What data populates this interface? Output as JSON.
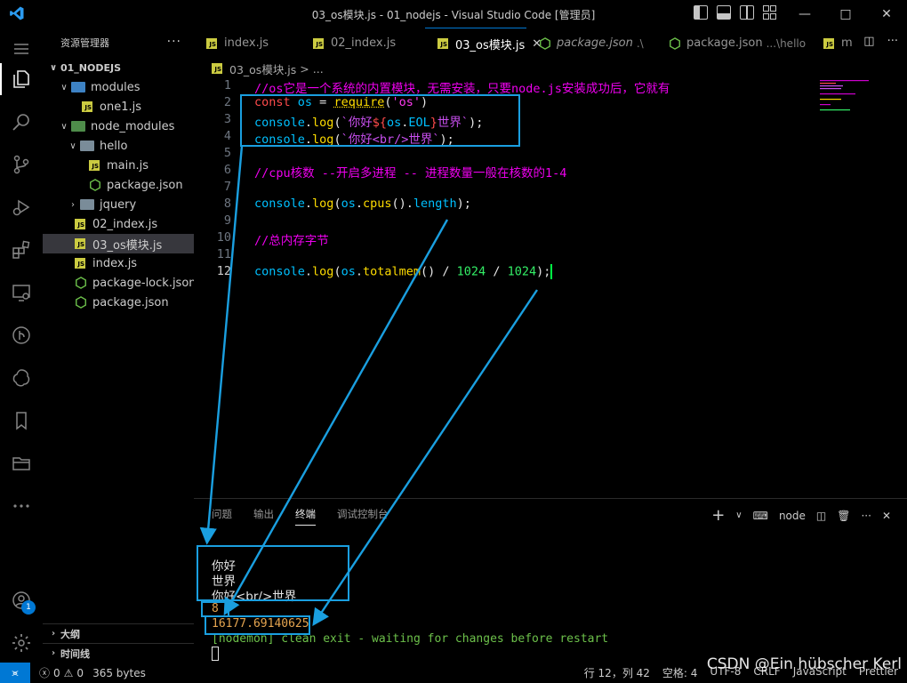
{
  "window": {
    "title": "03_os模块.js - 01_nodejs - Visual Studio Code [管理员]"
  },
  "sidebar": {
    "header": "资源管理器",
    "more": "···",
    "root": "01_NODEJS",
    "tree": [
      {
        "label": "modules",
        "type": "folder"
      },
      {
        "label": "one1.js",
        "type": "js"
      },
      {
        "label": "node_modules",
        "type": "folder"
      },
      {
        "label": "hello",
        "type": "folder"
      },
      {
        "label": "main.js",
        "type": "js"
      },
      {
        "label": "package.json",
        "type": "node"
      },
      {
        "label": "jquery",
        "type": "folder"
      },
      {
        "label": "02_index.js",
        "type": "js"
      },
      {
        "label": "03_os模块.js",
        "type": "js",
        "selected": true
      },
      {
        "label": "index.js",
        "type": "js"
      },
      {
        "label": "package-lock.json",
        "type": "node"
      },
      {
        "label": "package.json",
        "type": "node"
      }
    ],
    "outline": "大纲",
    "timeline": "时间线"
  },
  "tabs": [
    {
      "label": "index.js"
    },
    {
      "label": "02_index.js"
    },
    {
      "label": "03_os模块.js",
      "active": true
    },
    {
      "label": "package.json",
      "detail": ".\\"
    },
    {
      "label": "package.json",
      "detail": "...\\hello"
    },
    {
      "label": "m"
    }
  ],
  "breadcrumb": {
    "file": "03_os模块.js",
    "sep": ">",
    "more": "..."
  },
  "editor": {
    "line_numbers": [
      "1",
      "2",
      "3",
      "4",
      "5",
      "6",
      "7",
      "8",
      "9",
      "10",
      "11",
      "12"
    ],
    "line1": "//os它是一个系统的内置模块，无需安装，只要node.js安装成功后，它就有",
    "line2": {
      "kw": "const",
      "var": "os",
      "eq": " = ",
      "fn": "require",
      "p1": "(",
      "str": "'os'",
      "p2": ")"
    },
    "line3": {
      "obj": "console",
      "dot": ".",
      "fn": "log",
      "p1": "(",
      "t1": "`你好",
      "t2": "${",
      "v": "os",
      "d": ".",
      "v2": "EOL",
      "t3": "}",
      "t4": "世界`",
      "p2": ");"
    },
    "line4": {
      "obj": "console",
      "dot": ".",
      "fn": "log",
      "p1": "(",
      "t1": "`你好<br/>世界`",
      "p2": ");"
    },
    "line6": "//cpu核数 --开启多进程 -- 进程数量一般在核数的1-4",
    "line8": {
      "obj": "console",
      "dot": ".",
      "fn": "log",
      "p1": "(",
      "v": "os",
      "d": ".",
      "fn2": "cpus",
      "p2": "().",
      "prop": "length",
      "p3": ");"
    },
    "line10": "//总内存字节",
    "line12": {
      "obj": "console",
      "dot": ".",
      "fn": "log",
      "p1": "(",
      "v": "os",
      "d": ".",
      "fn2": "totalmem",
      "p2": "()",
      "op1": " / ",
      "n1": "1024",
      "op2": " / ",
      "n2": "1024",
      "p3": ");"
    }
  },
  "panel": {
    "tabs": [
      "问题",
      "输出",
      "终端",
      "调试控制台"
    ],
    "active_tab": "终端",
    "shell": "node",
    "terminal": [
      {
        "text": "你好",
        "style": "white"
      },
      {
        "text": "世界",
        "style": "white"
      },
      {
        "text": "你好<br/>世界",
        "style": "white"
      },
      {
        "text": "8",
        "style": "orange"
      },
      {
        "text": "16177.69140625",
        "style": "orange"
      },
      {
        "text": "[nodemon] clean exit - waiting for changes before restart",
        "style": "green"
      }
    ]
  },
  "statusbar": {
    "errors": "0",
    "warnings": "0",
    "filesize": "365 bytes",
    "position": "行 12，列 42",
    "spaces": "空格: 4",
    "encoding": "UTF-8",
    "eol": "CRLF",
    "language": "JavaScript",
    "formatter": "Prettier",
    "watermark": "CSDN @Ein hübscher Kerl"
  },
  "accounts_badge": "1",
  "colors": {
    "accent": "#0078d4",
    "annotation": "#1a9fe0",
    "comment": "#ee00ee",
    "keyword": "#ff4b4b",
    "variable": "#00c0ff",
    "function": "#ffdd00",
    "number": "#33ee66",
    "terminal_number": "#e5a550",
    "terminal_nodemon": "#6cc04a"
  }
}
